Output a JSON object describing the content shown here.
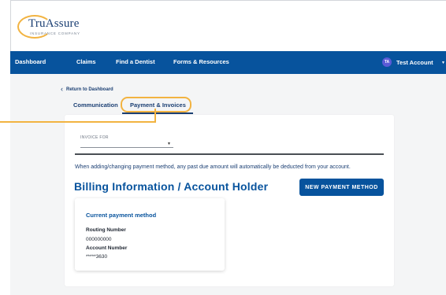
{
  "logo": {
    "name": "TruAssure",
    "tagline": "INSURANCE COMPANY"
  },
  "nav": {
    "items": [
      {
        "label": "Dashboard"
      },
      {
        "label": "Claims"
      },
      {
        "label": "Find a Dentist"
      },
      {
        "label": "Forms & Resources"
      }
    ],
    "account": {
      "initials": "TA",
      "name": "Test Account",
      "avatar_color": "#5b5bd6"
    }
  },
  "return_link": "Return to Dashboard",
  "tabs": [
    {
      "label": "Communication",
      "selected": false
    },
    {
      "label": "Payment & Invoices",
      "selected": true
    }
  ],
  "invoice": {
    "label": "INVOICE FOR",
    "value": ""
  },
  "notice": "When adding/changing payment method, any past due amount will automatically be deducted from your account.",
  "billing_title": "Billing Information / Account Holder",
  "new_payment_button": "NEW PAYMENT METHOD",
  "payment_card": {
    "title": "Current payment method",
    "routing_label": "Routing Number",
    "routing_value": "000000000",
    "account_label": "Account Number",
    "account_value": "*****3630"
  },
  "colors": {
    "primary": "#07539d",
    "highlight": "#f2b341",
    "background": "#f4f5f6"
  }
}
